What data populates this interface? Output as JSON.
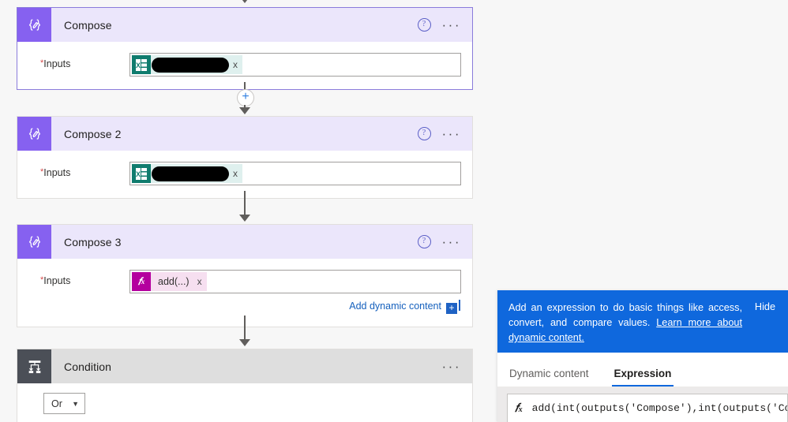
{
  "canvas": {
    "cards": [
      {
        "id": "compose",
        "icon_name": "compose-icon",
        "title": "Compose",
        "selected": true,
        "help_icon": "help-circle-icon",
        "more_icon": "ellipsis-icon",
        "field": {
          "label": "Inputs",
          "required_marker": "*",
          "token_type": "dynamic",
          "token_icon": "excel-file-icon",
          "token_label": "",
          "token_redacted": true,
          "remove_icon": "x"
        },
        "add_dynamic_content": null
      },
      {
        "id": "compose-2",
        "icon_name": "compose-icon",
        "title": "Compose 2",
        "selected": false,
        "help_icon": "help-circle-icon",
        "more_icon": "ellipsis-icon",
        "field": {
          "label": "Inputs",
          "required_marker": "*",
          "token_type": "dynamic",
          "token_icon": "excel-file-icon",
          "token_label": "",
          "token_redacted": true,
          "remove_icon": "x"
        },
        "add_dynamic_content": null
      },
      {
        "id": "compose-3",
        "icon_name": "compose-icon",
        "title": "Compose 3",
        "selected": false,
        "help_icon": "help-circle-icon",
        "more_icon": "ellipsis-icon",
        "field": {
          "label": "Inputs",
          "required_marker": "*",
          "token_type": "expression",
          "token_icon": "fx-icon",
          "token_label": "add(...)",
          "token_redacted": false,
          "remove_icon": "x"
        },
        "add_dynamic_content": {
          "label": "Add dynamic content",
          "button_icon": "plus-icon",
          "button_glyph": "+"
        }
      },
      {
        "id": "condition",
        "icon_name": "condition-icon",
        "title": "Condition",
        "selected": false,
        "help_icon": null,
        "more_icon": "ellipsis-icon",
        "field": null,
        "operator_select": {
          "value": "Or",
          "chevron_icon": "chevron-down-icon"
        }
      }
    ],
    "connectors": {
      "add_step_button_glyph": "+",
      "add_step_icon": "plus-circle-icon"
    }
  },
  "expression_panel": {
    "banner": {
      "text_before_link": "Add an expression to do basic things like access, convert, and compare values. ",
      "link_text": "Learn more about dynamic content.",
      "hide_label": "Hide",
      "background": "#0f68dd"
    },
    "tabs": [
      {
        "label": "Dynamic content",
        "active": false
      },
      {
        "label": "Expression",
        "active": true
      }
    ],
    "expression_input": {
      "fx_label": "fx",
      "value": "add(int(outputs('Compose'),int(outputs('Co",
      "placeholder": "add(int(outputs('Compose'),int(outputs('Co"
    }
  },
  "colors": {
    "accent_purple": "#8661f0",
    "header_purple": "#ebe6fb",
    "selected_border": "#8a7bdb",
    "condition_icon": "#4b4f57",
    "condition_header": "#dedede",
    "link_blue": "#1560bd",
    "banner_blue": "#0f68dd",
    "token_teal": "#107c6e",
    "token_magenta": "#b4009e"
  }
}
